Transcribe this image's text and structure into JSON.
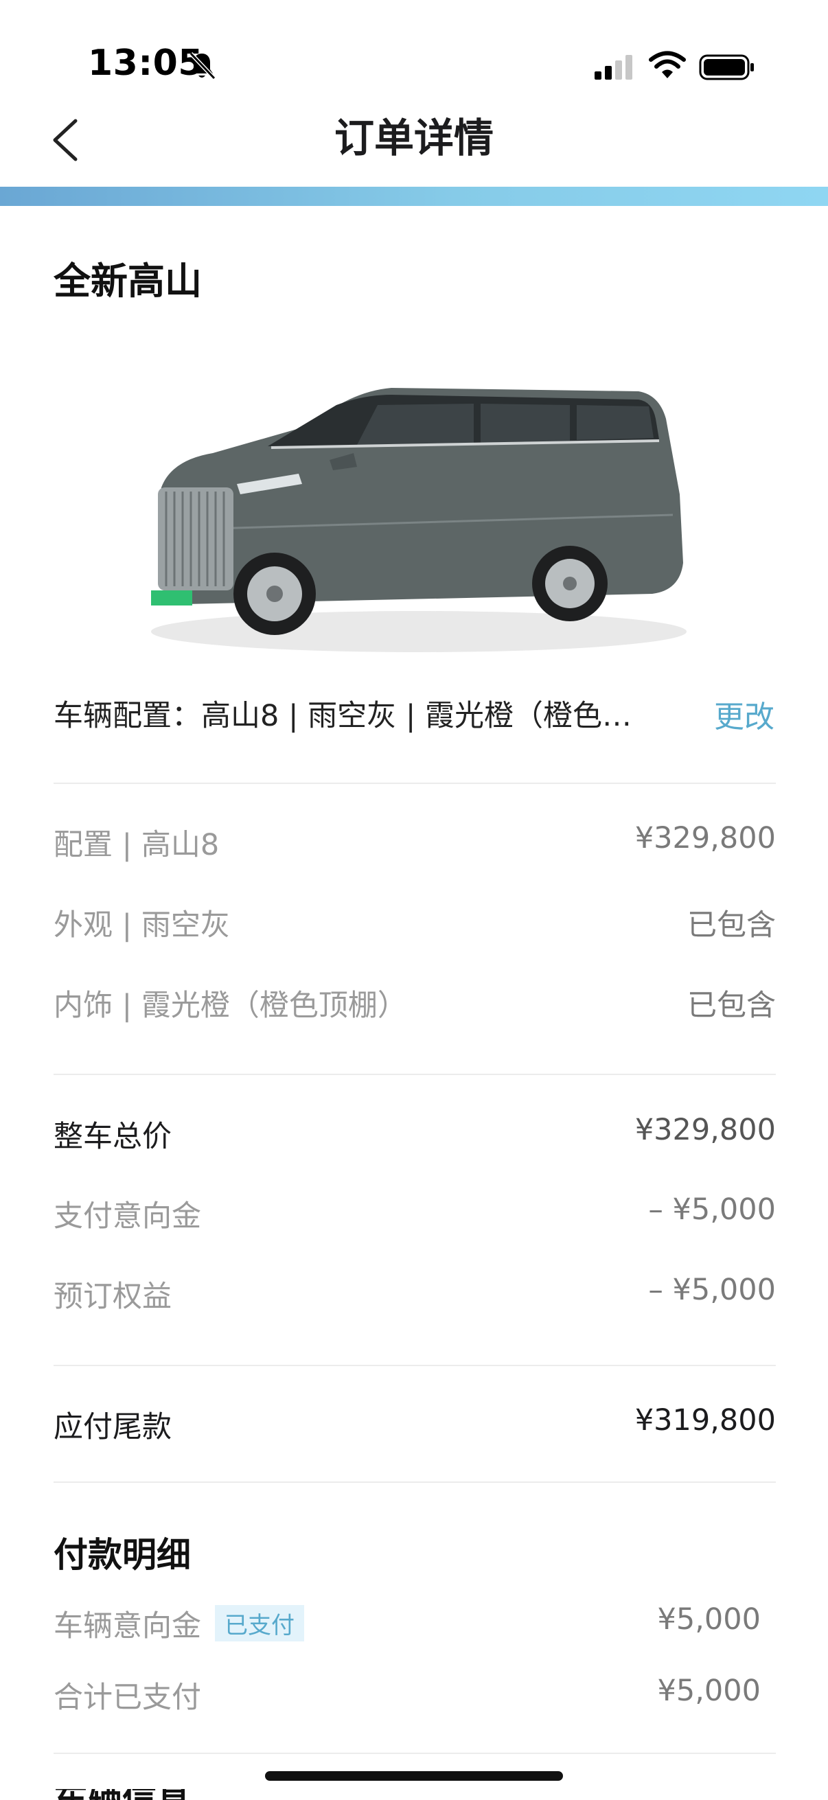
{
  "status": {
    "time": "13:05"
  },
  "nav": {
    "title": "订单详情"
  },
  "order": {
    "model_name": "全新高山",
    "config_summary": "车辆配置：高山8 | 雨空灰 | 霞光橙（橙色…",
    "change_label": "更改"
  },
  "config_items": [
    {
      "label": "配置 | 高山8",
      "value": "¥329,800"
    },
    {
      "label": "外观 | 雨空灰",
      "value": "已包含"
    },
    {
      "label": "内饰 | 霞光橙（橙色顶棚）",
      "value": "已包含"
    }
  ],
  "price_items": [
    {
      "label": "整车总价",
      "value": "¥329,800"
    },
    {
      "label": "支付意向金",
      "value": "– ¥5,000"
    },
    {
      "label": "预订权益",
      "value": "– ¥5,000"
    }
  ],
  "balance": {
    "label": "应付尾款",
    "value": "¥319,800"
  },
  "payment_detail": {
    "title": "付款明细",
    "items": [
      {
        "label": "车辆意向金",
        "badge": "已支付",
        "value": "¥5,000"
      },
      {
        "label": "合计已支付",
        "value": "¥5,000"
      }
    ]
  },
  "next_section_partial": "车辆信息",
  "colors": {
    "accent": "#57a9cc",
    "bar_start": "#6aa7d4",
    "bar_end": "#8fd6f2"
  }
}
